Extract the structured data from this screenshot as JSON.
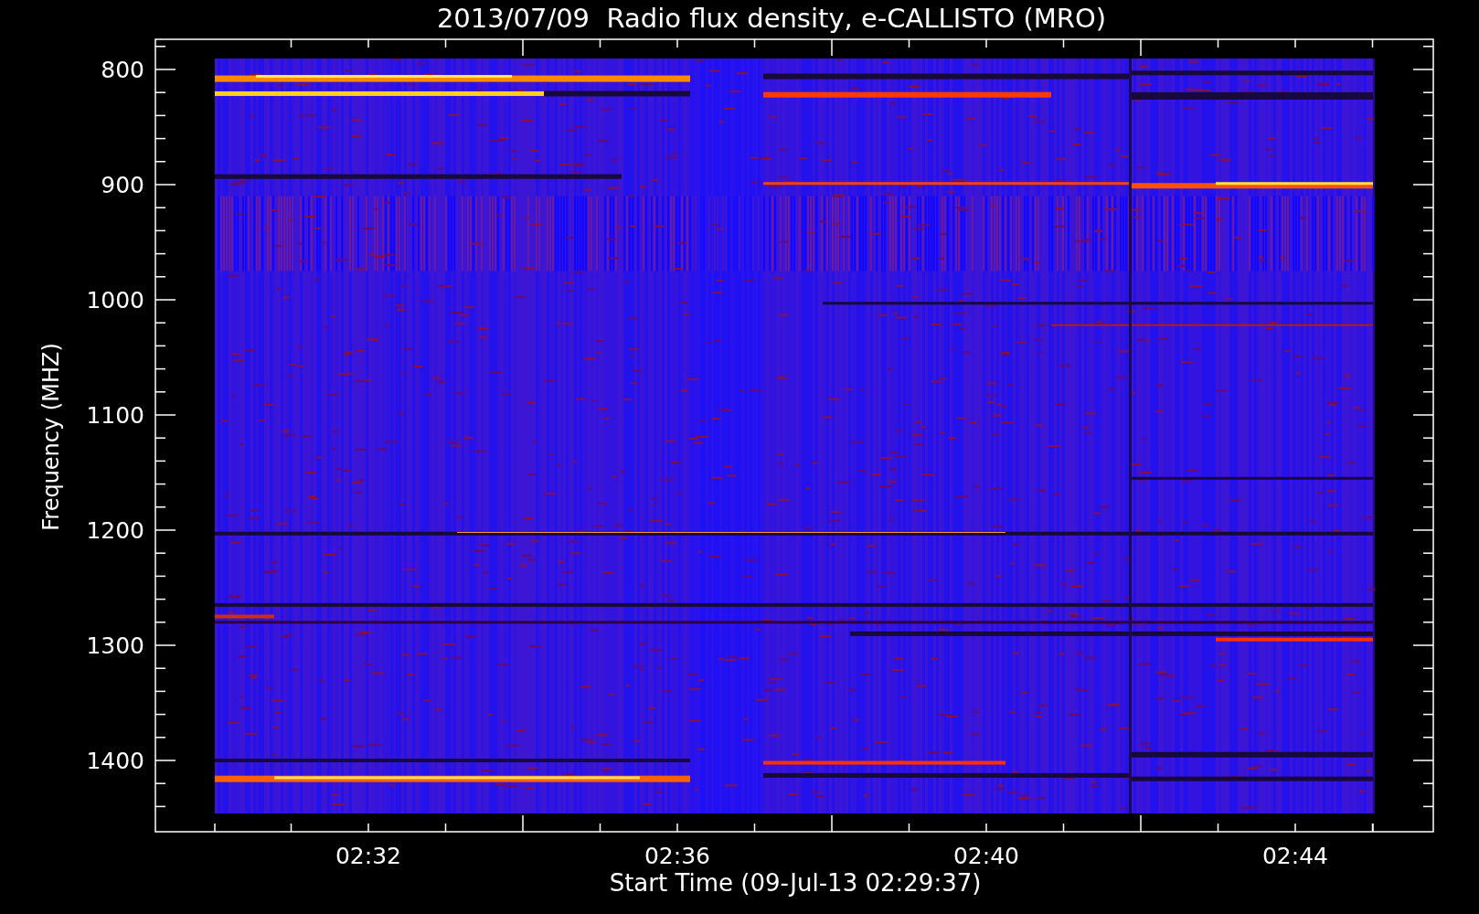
{
  "title": "2013/07/09  Radio flux density, e-CALLISTO (MRO)",
  "y_axis": {
    "label": "Frequency (MHZ)",
    "ticks": [
      "800",
      "900",
      "1000",
      "1100",
      "1200",
      "1300",
      "1400"
    ]
  },
  "x_axis": {
    "label": "Start Time (09-Jul-13 02:29:37)",
    "ticks": [
      "02:32",
      "02:36",
      "02:40",
      "02:44"
    ]
  }
}
